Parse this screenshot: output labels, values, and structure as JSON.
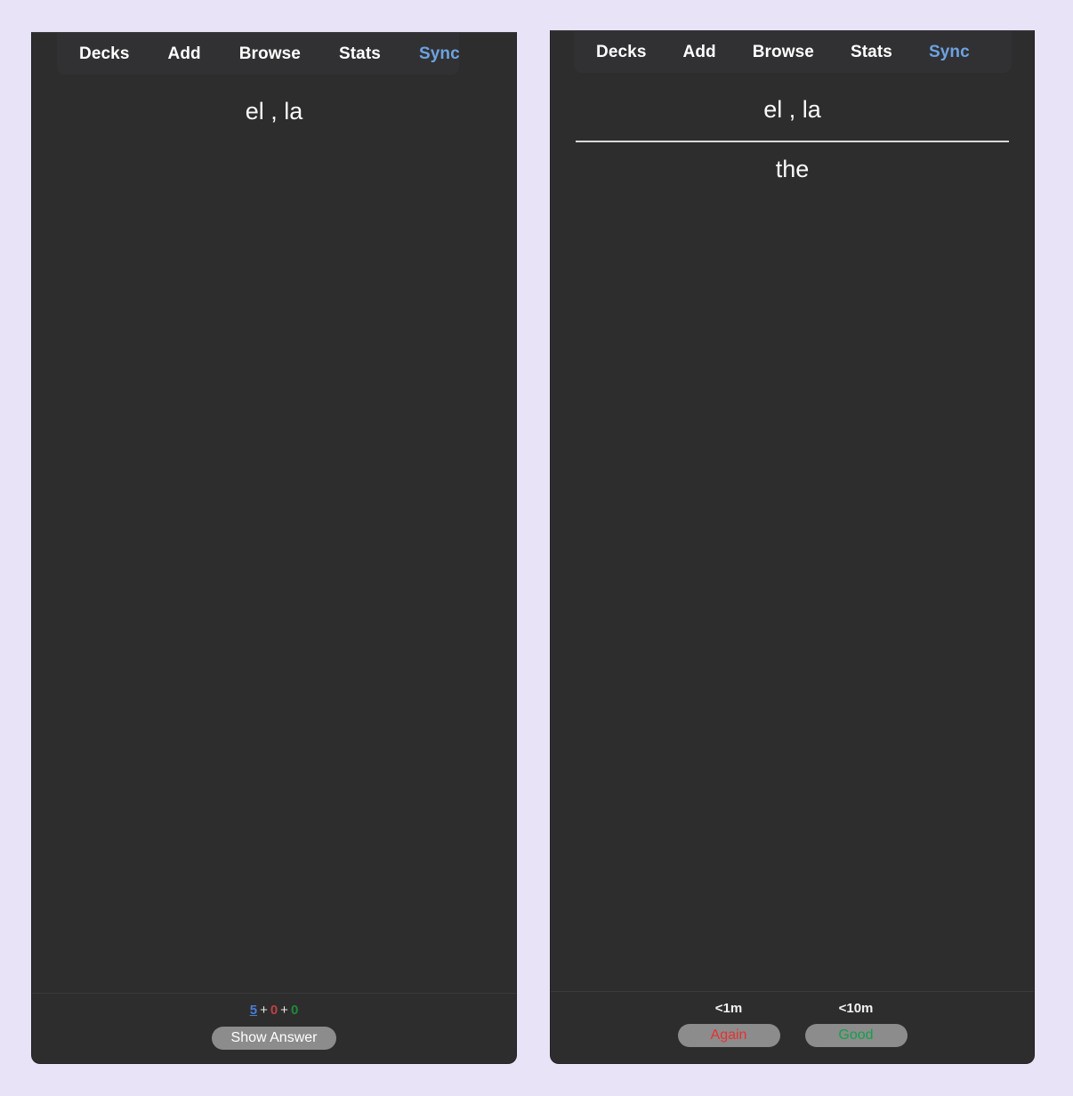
{
  "app": {
    "name": "Anki",
    "theme_background": "#e9e3f7",
    "panel_background": "#2d2d2d"
  },
  "navbar": {
    "items": [
      {
        "label": "Decks",
        "name": "decks",
        "color": "#ffffff"
      },
      {
        "label": "Add",
        "name": "add",
        "color": "#ffffff"
      },
      {
        "label": "Browse",
        "name": "browse",
        "color": "#ffffff"
      },
      {
        "label": "Stats",
        "name": "stats",
        "color": "#ffffff"
      },
      {
        "label": "Sync",
        "name": "sync",
        "color": "#6da3e0"
      }
    ]
  },
  "panels": [
    {
      "state": "question",
      "card": {
        "question": "el , la",
        "answer": null,
        "divider_visible": false
      },
      "bottom": {
        "counts": {
          "new": "5",
          "learning": "0",
          "review": "0",
          "separator": "+",
          "new_color": "#4a7dd4",
          "learning_color": "#bf4045",
          "review_color": "#1f8a3c"
        },
        "show_answer_label": "Show Answer"
      }
    },
    {
      "state": "answer",
      "card": {
        "question": "el , la",
        "answer": "the",
        "divider_visible": true
      },
      "bottom": {
        "ease_buttons": [
          {
            "interval": "<1m",
            "label": "Again",
            "color": "#e8302f"
          },
          {
            "interval": "<10m",
            "label": "Good",
            "color": "#13a04a"
          }
        ]
      }
    }
  ]
}
